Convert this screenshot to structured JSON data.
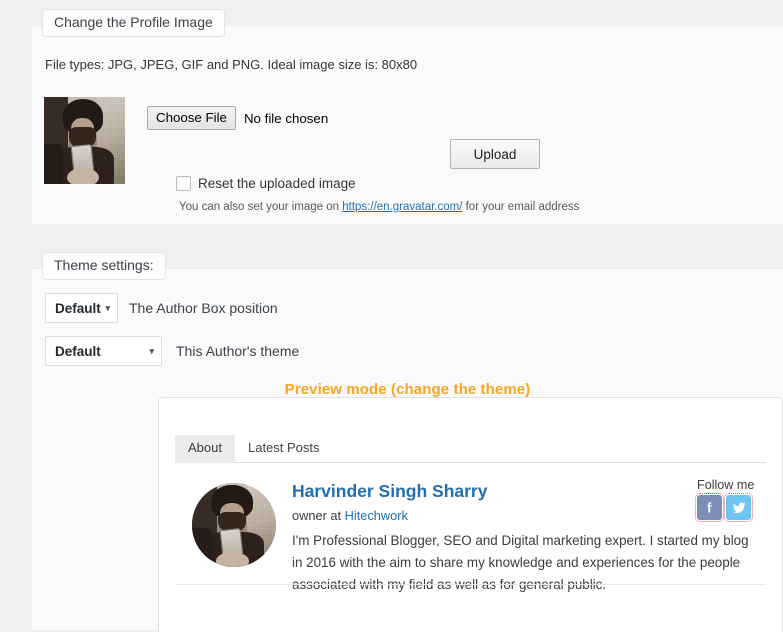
{
  "profile_section": {
    "legend": "Change the Profile Image",
    "filetypes_note": "File types: JPG, JPEG, GIF and PNG. Ideal image size is: 80x80",
    "choose_file_button": "Choose File",
    "no_file_text": "No file chosen",
    "upload_button": "Upload",
    "reset_checkbox_label": "Reset the uploaded image",
    "gravatar_note_before": "You can also set your image on ",
    "gravatar_link": "https://en.gravatar.com/",
    "gravatar_note_after": " for your email address",
    "avatar_alt": "profile-photo"
  },
  "theme_section": {
    "legend": "Theme settings:",
    "position_select": {
      "value": "Default",
      "options": [
        "Default"
      ],
      "description": "The Author Box position",
      "caret": "▾"
    },
    "theme_select": {
      "value": "Default",
      "options": [
        "Default"
      ],
      "description": "This Author's theme",
      "caret": "▾"
    },
    "preview_title": "Preview mode (change the theme)"
  },
  "preview": {
    "tabs": [
      {
        "label": "About",
        "active": true
      },
      {
        "label": "Latest Posts",
        "active": false
      }
    ],
    "author": {
      "name": "Harvinder Singh Sharry",
      "role_prefix": "owner at ",
      "company": "Hitechwork",
      "bio": "I'm Professional Blogger, SEO and Digital marketing expert. I started my blog in 2016 with the aim to share my knowledge and experiences for the people associated with my field as well as for general public.",
      "avatar_alt": "author-photo"
    },
    "follow": {
      "label": "Follow me",
      "links": [
        {
          "name": "facebook",
          "color": "#7e8cb8"
        },
        {
          "name": "twitter",
          "color": "#6ec5f0"
        }
      ]
    }
  },
  "colors": {
    "page_background": "#f0f0f0",
    "panel_background": "#fafafa",
    "preview_title": "#f5a623",
    "link": "#2271b1",
    "author_name": "#1f6fb2"
  }
}
